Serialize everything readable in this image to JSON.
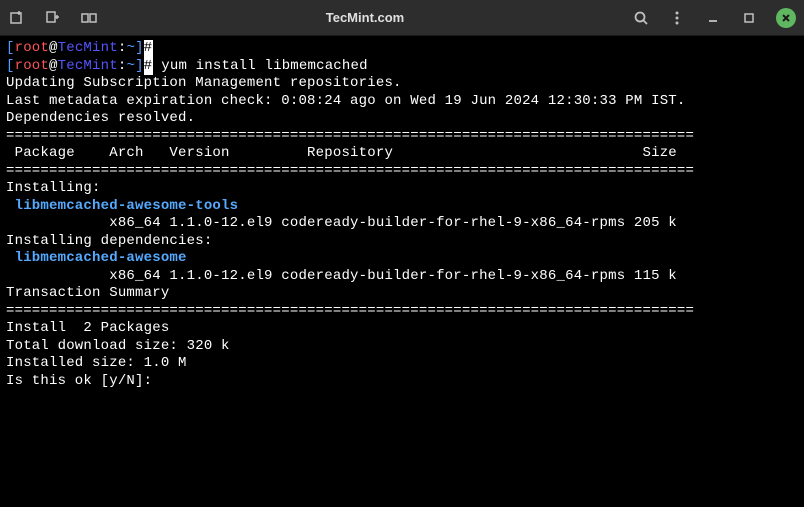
{
  "titlebar": {
    "title": "TecMint.com"
  },
  "prompt1": {
    "open": "[",
    "user": "root",
    "at": "@",
    "host": "TecMint",
    "sep": ":",
    "path": "~",
    "close": "]",
    "hash": "#"
  },
  "prompt2": {
    "open": "[",
    "user": "root",
    "at": "@",
    "host": "TecMint",
    "sep": ":",
    "path": "~",
    "close": "]",
    "hash": "#",
    "cmd": " yum install libmemcached"
  },
  "output": {
    "l1": "Updating Subscription Management repositories.",
    "l2": "Last metadata expiration check: 0:08:24 ago on Wed 19 Jun 2024 12:30:33 PM IST.",
    "l3": "Dependencies resolved.",
    "rule": "================================================================================",
    "header": " Package    Arch   Version         Repository                             Size",
    "installing": "Installing:",
    "pkg1": " libmemcached-awesome-tools",
    "pkg1_detail": "            x86_64 1.1.0-12.el9 codeready-builder-for-rhel-9-x86_64-rpms 205 k",
    "installing_deps": "Installing dependencies:",
    "pkg2": " libmemcached-awesome",
    "pkg2_detail": "            x86_64 1.1.0-12.el9 codeready-builder-for-rhel-9-x86_64-rpms 115 k",
    "blank": "",
    "trans_summary": "Transaction Summary",
    "install_count": "Install  2 Packages",
    "total_dl": "Total download size: 320 k",
    "installed_size": "Installed size: 1.0 M",
    "confirm": "Is this ok [y/N]: "
  }
}
